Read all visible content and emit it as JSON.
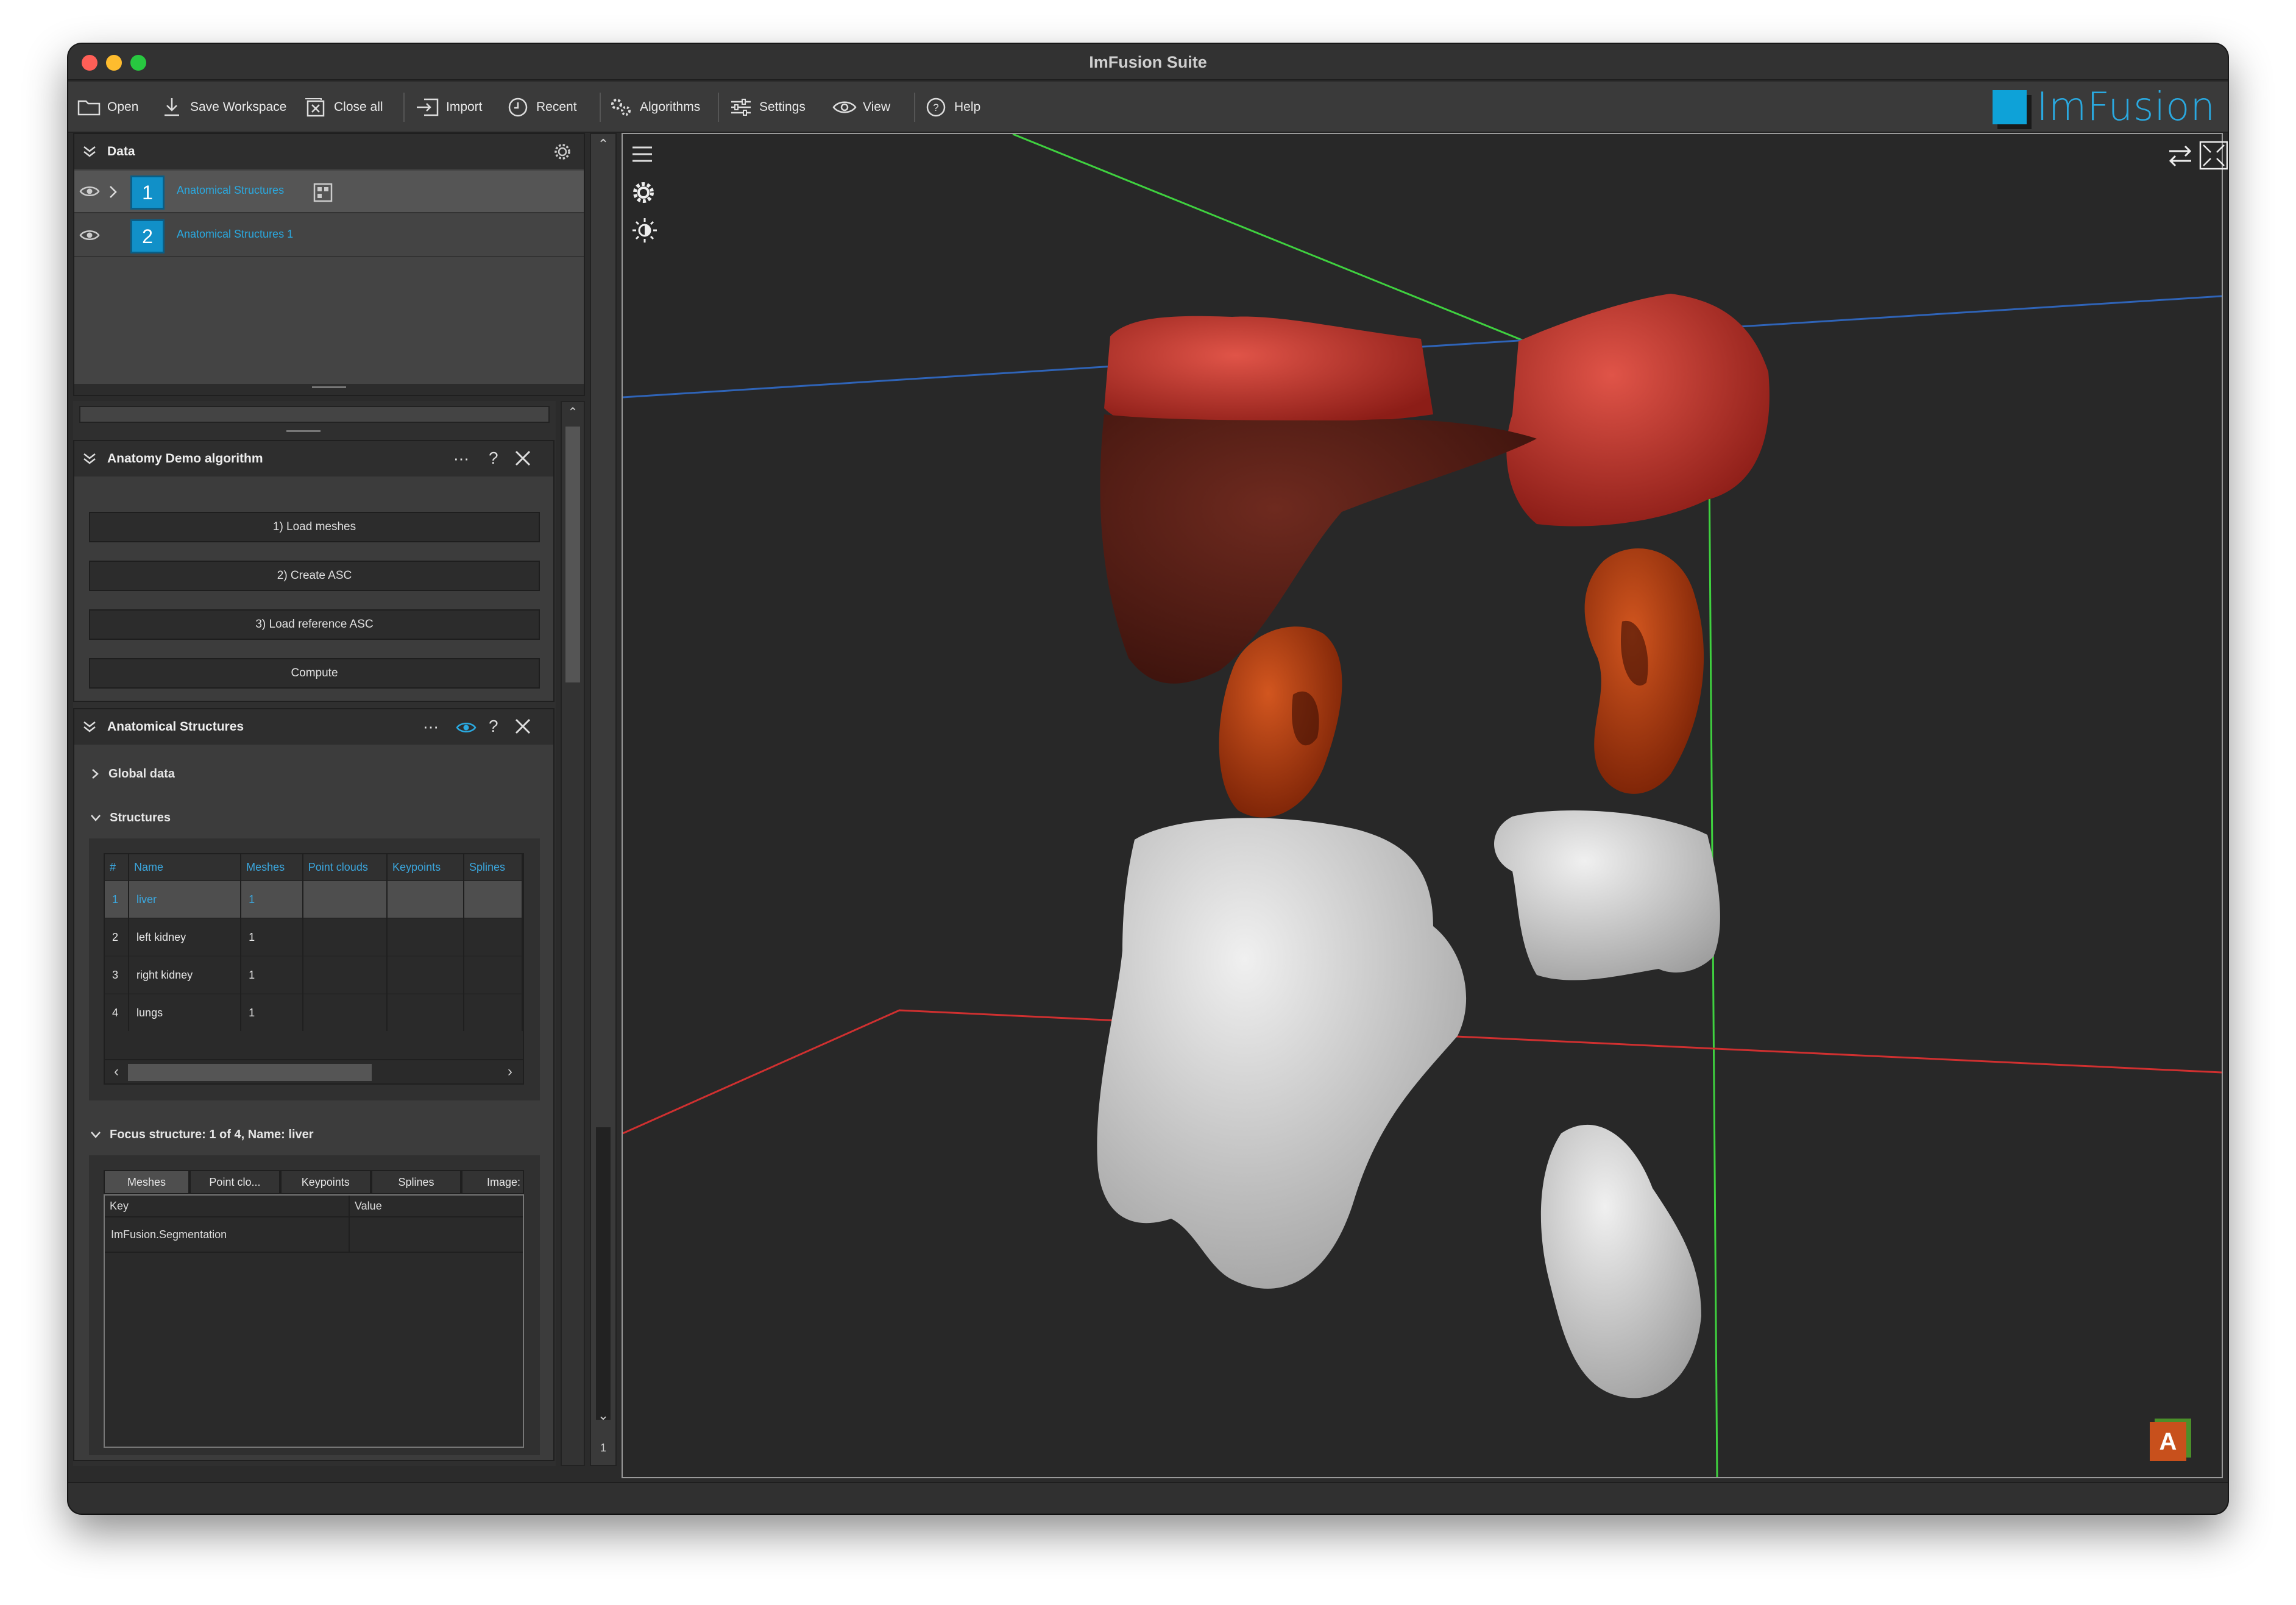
{
  "window": {
    "title": "ImFusion Suite"
  },
  "toolbar": {
    "open": "Open",
    "save_workspace": "Save Workspace",
    "close_all": "Close all",
    "import": "Import",
    "recent": "Recent",
    "algorithms": "Algorithms",
    "settings": "Settings",
    "view": "View",
    "help": "Help",
    "brand": "ImFusion"
  },
  "data_panel": {
    "title": "Data",
    "items": [
      {
        "index": "1",
        "name": "Anatomical Structures"
      },
      {
        "index": "2",
        "name": "Anatomical Structures 1"
      }
    ]
  },
  "algorithm_panel": {
    "title": "Anatomy Demo algorithm",
    "buttons": [
      "1) Load meshes",
      "2) Create ASC",
      "3) Load reference ASC",
      "Compute"
    ]
  },
  "structures_panel": {
    "title": "Anatomical Structures",
    "global_data": "Global data",
    "structures_label": "Structures",
    "columns": [
      "#",
      "Name",
      "Meshes",
      "Point clouds",
      "Keypoints",
      "Splines"
    ],
    "rows": [
      {
        "num": "1",
        "name": "liver",
        "meshes": "1"
      },
      {
        "num": "2",
        "name": "left kidney",
        "meshes": "1"
      },
      {
        "num": "3",
        "name": "right kidney",
        "meshes": "1"
      },
      {
        "num": "4",
        "name": "lungs",
        "meshes": "1"
      }
    ],
    "focus_label": "Focus structure: 1 of 4, Name:  liver",
    "tabs": [
      "Meshes",
      "Point clo...",
      "Keypoints",
      "Splines",
      "Image:"
    ],
    "kv_headers": {
      "key": "Key",
      "value": "Value"
    },
    "kv_rows": [
      {
        "key": "ImFusion.Segmentation",
        "value": ""
      }
    ]
  },
  "side_strip": {
    "page_number": "1"
  },
  "viewport": {
    "orientation_cube_letter": "A"
  },
  "colors": {
    "accent": "#2aa9e0",
    "axis_green": "#3fd13f",
    "axis_blue": "#2f64b8",
    "axis_red": "#d03030",
    "organ_red": "#c8322c",
    "liver": "#5b1e16",
    "kidney": "#c0441a",
    "bone_white": "#d9d9d9"
  }
}
